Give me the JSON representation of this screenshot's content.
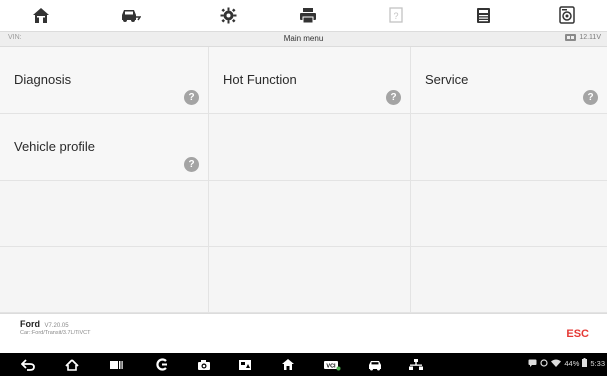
{
  "toolbar": {
    "icons": [
      "home-icon",
      "vehicle-swap-icon",
      "settings-gear-icon",
      "print-icon",
      "help-icon",
      "save-icon",
      "data-logging-icon"
    ]
  },
  "status_bar": {
    "vin_label": "VIN:",
    "title": "Main menu",
    "voltage": "12.11V"
  },
  "menu": {
    "items": [
      {
        "label": "Diagnosis",
        "help": "?"
      },
      {
        "label": "Hot Function",
        "help": "?"
      },
      {
        "label": "Service",
        "help": "?"
      },
      {
        "label": "Vehicle profile",
        "help": "?"
      }
    ]
  },
  "footer": {
    "make": "Ford",
    "version": "V7.20.05",
    "car_path": "Car::Ford/Transit/3.7L/TiVCT",
    "esc_label": "ESC"
  },
  "android_nav": {
    "icons": [
      "back-icon",
      "home-icon",
      "recents-icon",
      "browser-icon",
      "camera-icon",
      "screenshot-icon",
      "home2-icon",
      "vci-icon",
      "vehicle-icon",
      "network-icon"
    ],
    "battery_percent": "44%",
    "time": "5:33"
  },
  "colors": {
    "accent_red": "#e53935",
    "help_grey": "#a4a4a4",
    "nav_bg": "#000000"
  }
}
